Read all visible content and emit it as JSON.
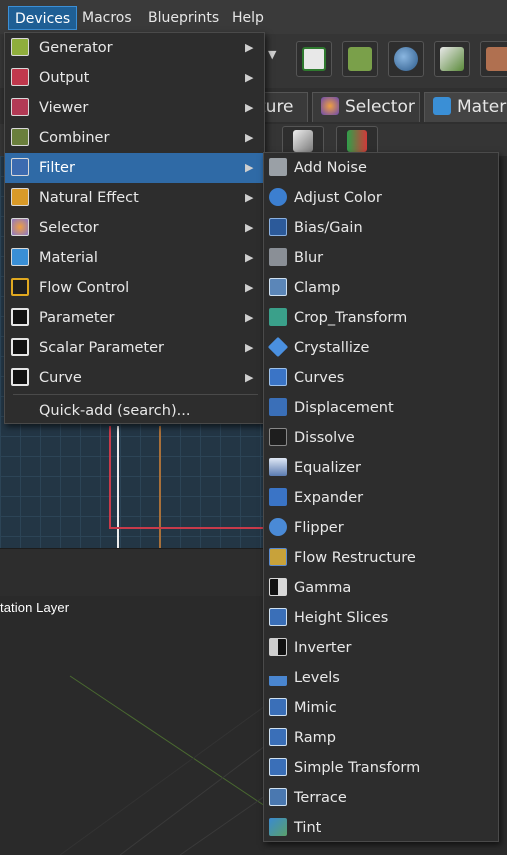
{
  "menubar": {
    "items": [
      {
        "label": "Devices",
        "active": true
      },
      {
        "label": "Macros",
        "active": false
      },
      {
        "label": "Blueprints",
        "active": false
      },
      {
        "label": "Help",
        "active": false
      }
    ]
  },
  "tabs": [
    {
      "label": "ture"
    },
    {
      "label": "Selector"
    },
    {
      "label": "Materi"
    }
  ],
  "viewport": {
    "label": "tation Layer"
  },
  "devices_menu": {
    "items": [
      {
        "label": "Generator",
        "icon": "generator-icon",
        "color": "#8fae3c",
        "submenu": true
      },
      {
        "label": "Output",
        "icon": "output-icon",
        "color": "#c0384d",
        "submenu": true
      },
      {
        "label": "Viewer",
        "icon": "viewer-icon",
        "color": "#b23a55",
        "submenu": true
      },
      {
        "label": "Combiner",
        "icon": "combiner-icon",
        "color": "#6a7f3c",
        "submenu": true
      },
      {
        "label": "Filter",
        "icon": "filter-icon",
        "color": "#3c6bb0",
        "submenu": true,
        "highlighted": true
      },
      {
        "label": "Natural Effect",
        "icon": "natural-effect-icon",
        "color": "#d99a28",
        "submenu": true
      },
      {
        "label": "Selector",
        "icon": "selector-icon",
        "color": "#8a78c8",
        "submenu": true
      },
      {
        "label": "Material",
        "icon": "material-icon",
        "color": "#3a8fd6",
        "submenu": true
      },
      {
        "label": "Flow Control",
        "icon": "flow-control-icon",
        "color": "#e0a820",
        "submenu": true
      },
      {
        "label": "Parameter",
        "icon": "parameter-icon",
        "color": "#e6e6e6",
        "submenu": true
      },
      {
        "label": "Scalar Parameter",
        "icon": "scalar-parameter-icon",
        "color": "#e6e6e6",
        "submenu": true
      },
      {
        "label": "Curve",
        "icon": "curve-icon",
        "color": "#e6e6e6",
        "submenu": true
      }
    ],
    "quick_add": "Quick-add (search)..."
  },
  "filter_menu": {
    "items": [
      {
        "label": "Add Noise",
        "icon": "add-noise-icon",
        "color": "#9aa0a6"
      },
      {
        "label": "Adjust Color",
        "icon": "adjust-color-icon",
        "color": "#3c7fd0"
      },
      {
        "label": "Bias/Gain",
        "icon": "bias-gain-icon",
        "color": "#2c5a9a"
      },
      {
        "label": "Blur",
        "icon": "blur-icon",
        "color": "#8a8f96"
      },
      {
        "label": "Clamp",
        "icon": "clamp-icon",
        "color": "#5b86b8"
      },
      {
        "label": "Crop_Transform",
        "icon": "crop-transform-icon",
        "color": "#3aa08a"
      },
      {
        "label": "Crystallize",
        "icon": "crystallize-icon",
        "color": "#4a90e0"
      },
      {
        "label": "Curves",
        "icon": "curves-icon",
        "color": "#3a74c6"
      },
      {
        "label": "Displacement",
        "icon": "displacement-icon",
        "color": "#3a6fb8"
      },
      {
        "label": "Dissolve",
        "icon": "dissolve-icon",
        "color": "#1e1e1e"
      },
      {
        "label": "Equalizer",
        "icon": "equalizer-icon",
        "color": "#5a7bb0"
      },
      {
        "label": "Expander",
        "icon": "expander-icon",
        "color": "#3a74c6"
      },
      {
        "label": "Flipper",
        "icon": "flipper-icon",
        "color": "#4a8ad6"
      },
      {
        "label": "Flow Restructure",
        "icon": "flow-restructure-icon",
        "color": "#c8a23a"
      },
      {
        "label": "Gamma",
        "icon": "gamma-icon",
        "color": "#d8d8d8"
      },
      {
        "label": "Height Slices",
        "icon": "height-slices-icon",
        "color": "#3a6fb8"
      },
      {
        "label": "Inverter",
        "icon": "inverter-icon",
        "color": "#cfcfcf"
      },
      {
        "label": "Levels",
        "icon": "levels-icon",
        "color": "#4a86d0"
      },
      {
        "label": "Mimic",
        "icon": "mimic-icon",
        "color": "#3a6fb8"
      },
      {
        "label": "Ramp",
        "icon": "ramp-icon",
        "color": "#3a6fb8"
      },
      {
        "label": "Simple Transform",
        "icon": "simple-transform-icon",
        "color": "#3a6fb8"
      },
      {
        "label": "Terrace",
        "icon": "terrace-icon",
        "color": "#4a78b0"
      },
      {
        "label": "Tint",
        "icon": "tint-icon",
        "color": "#5aa06a"
      }
    ]
  },
  "colors": {
    "menu_bg": "#2d2d2d",
    "highlight": "#2f6aa6",
    "graph_bg": "#233645"
  }
}
